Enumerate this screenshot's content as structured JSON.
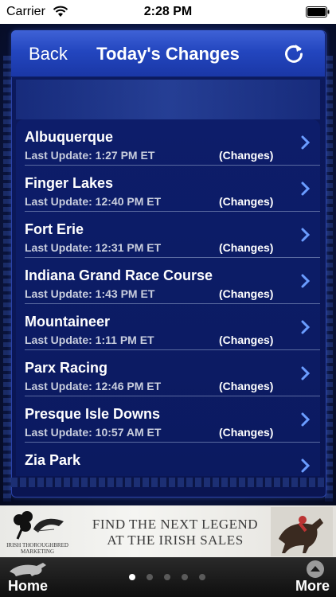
{
  "status_bar": {
    "carrier": "Carrier",
    "time": "2:28 PM"
  },
  "nav": {
    "back_label": "Back",
    "title": "Today's Changes"
  },
  "tracks": [
    {
      "name": "Albuquerque",
      "update": "Last Update: 1:27 PM ET",
      "changes": "(Changes)"
    },
    {
      "name": "Finger Lakes",
      "update": "Last Update: 12:40 PM ET",
      "changes": "(Changes)"
    },
    {
      "name": "Fort Erie",
      "update": "Last Update: 12:31 PM ET",
      "changes": "(Changes)"
    },
    {
      "name": "Indiana Grand Race Course",
      "update": "Last Update: 1:43 PM ET",
      "changes": "(Changes)"
    },
    {
      "name": "Mountaineer",
      "update": "Last Update: 1:11 PM ET",
      "changes": "(Changes)"
    },
    {
      "name": "Parx Racing",
      "update": "Last Update: 12:46 PM ET",
      "changes": "(Changes)"
    },
    {
      "name": "Presque Isle Downs",
      "update": "Last Update: 10:57 AM ET",
      "changes": "(Changes)"
    },
    {
      "name": "Zia Park",
      "update": "",
      "changes": ""
    }
  ],
  "ad": {
    "logo_text": "IRISH THOROUGHBRED MARKETING",
    "headline_line1": "FIND THE NEXT LEGEND",
    "headline_line2": "AT THE IRISH SALES"
  },
  "bottom_bar": {
    "home_label": "Home",
    "more_label": "More",
    "page_count": 5,
    "active_page": 1
  },
  "colors": {
    "nav_blue": "#2346bf",
    "list_bg": "#0d1d6a",
    "chevron": "#6a9cff"
  }
}
